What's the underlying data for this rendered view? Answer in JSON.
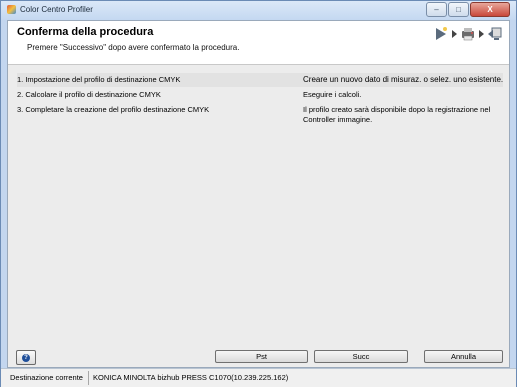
{
  "window": {
    "title": "Color Centro Profiler",
    "minimize_glyph": "–",
    "maximize_glyph": "□",
    "close_glyph": "X"
  },
  "header": {
    "title": "Conferma della procedura",
    "subtitle": "Premere \"Successivo\" dopo avere confermato la procedura.",
    "step_icons": [
      "wizard-start-icon",
      "printer-icon",
      "monitor-target-icon"
    ]
  },
  "steps": [
    {
      "label": "1. Impostazione del profilo di destinazione CMYK",
      "description": "Creare un nuovo dato di misuraz. o selez. uno esistente."
    },
    {
      "label": "2. Calcolare il profilo di destinazione CMYK",
      "description": "Eseguire i calcoli."
    },
    {
      "label": "3. Completare la creazione del profilo destinazione CMYK",
      "description": "Il profilo creato sarà disponibile dopo la registrazione nel Controller immagine."
    }
  ],
  "buttons": {
    "help": "?",
    "back": "Pst",
    "next": "Succ",
    "cancel": "Annulla"
  },
  "statusbar": {
    "label": "Destinazione corrente",
    "value": "KONICA MINOLTA bizhub PRESS C1070(10.239.225.162)"
  }
}
